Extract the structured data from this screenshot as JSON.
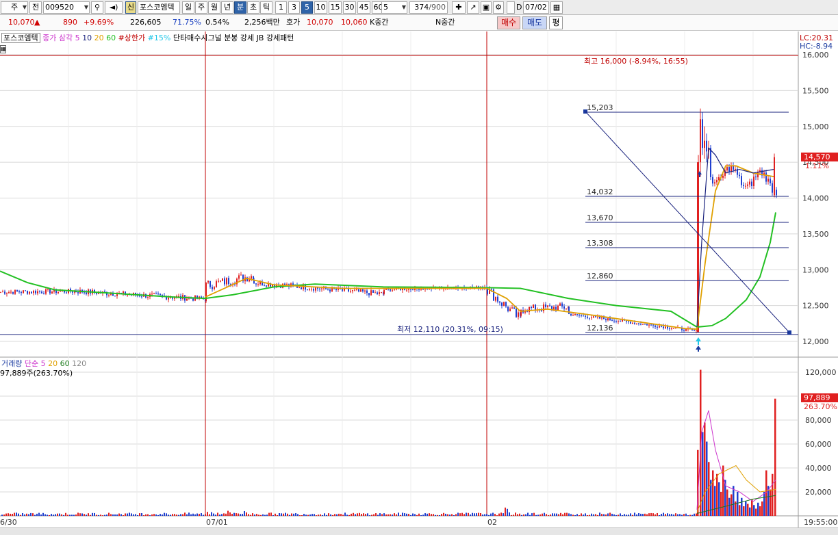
{
  "toolbar": {
    "market": "주",
    "prev_label": "전",
    "code": "009520",
    "stock_name": "포스코엠텍",
    "credit_badge": "신",
    "period_tabs": [
      "일",
      "주",
      "월",
      "년",
      "분",
      "초",
      "틱"
    ],
    "active_period": "분",
    "interval_tabs": [
      "1",
      "3",
      "5",
      "10",
      "15",
      "30",
      "45",
      "60"
    ],
    "active_interval": "5",
    "interval_value": "5",
    "count": "374",
    "count_total": "/900",
    "date": "07/02",
    "checkbox_label": "D"
  },
  "quote": {
    "price": "10,070",
    "change": "890",
    "change_pct": "+9.69%",
    "volume": "226,605",
    "volume_ratio": "71.75%",
    "turnover": "0.54%",
    "amount": "2,256백만",
    "ask_label": "호가",
    "bid1": "10,070",
    "bid2": "10,060",
    "k_label": "K중간",
    "n_label": "N중간",
    "buy_button": "매수",
    "sell_button": "매도",
    "avg_button": "평"
  },
  "price_panel": {
    "legend": {
      "name": "포스코엠텍",
      "ma_label": "종가 삼각",
      "ma5": "5",
      "ma10": "10",
      "ma20": "20",
      "ma60": "60",
      "upper_limit": "#상한가",
      "pct15": "#15%",
      "signal": "단타매수시그널",
      "pattern": "분봉 강세 JB 강세패턴"
    },
    "lc": "LC:20.31",
    "hc": "HC:-8.94",
    "high_annotation": "최고 16,000 (-8.94%, 16:55)",
    "low_annotation": "최저 12,110 (20.31%, 09:15)",
    "fib_levels": [
      "15,203",
      "14,032",
      "13,670",
      "13,308",
      "12,860",
      "12,136"
    ],
    "y_ticks": [
      "16,000",
      "15,500",
      "15,000",
      "14,500",
      "14,000",
      "13,500",
      "13,000",
      "12,500",
      "12,000"
    ],
    "current_price": "14,570",
    "current_pct": "1.11%"
  },
  "volume_panel": {
    "legend": {
      "label": "거래량",
      "ma_label": "단순",
      "ma5": "5",
      "ma20": "20",
      "ma60": "60",
      "ma120": "120",
      "value": "97,889주(263.70%)"
    },
    "y_ticks": [
      "120,000",
      "100,000",
      "80,000",
      "60,000",
      "40,000",
      "20,000"
    ],
    "current_volume": "97,889",
    "current_pct": "263.70%"
  },
  "x_axis": {
    "labels": [
      "6/30",
      "07/01",
      "02"
    ],
    "time": "19:55:00"
  },
  "colors": {
    "up": "#e02020",
    "down": "#1f3fd0",
    "ma5": "#cc33cc",
    "ma10": "#1a237e",
    "ma20": "#e0a000",
    "ma60": "#22c022",
    "grid": "#d8d8d8",
    "session_line": "#c00000"
  }
}
